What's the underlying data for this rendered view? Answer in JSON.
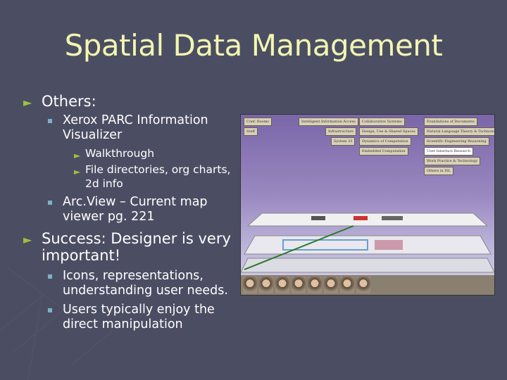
{
  "slide": {
    "title": "Spatial Data Management",
    "bullets": [
      {
        "text": "Others:",
        "sub": [
          {
            "lines": [
              "Xerox PARC Information",
              "Visualizer"
            ],
            "sub": [
              {
                "lines": [
                  "Walkthrough"
                ]
              },
              {
                "lines": [
                  "File directories, org charts,",
                  "2d info"
                ]
              }
            ]
          },
          {
            "lines": [
              "Arc.View – Current map",
              "viewer pg. 221"
            ]
          }
        ]
      },
      {
        "lines": [
          "Success: Designer is very",
          "important!"
        ],
        "sub": [
          {
            "lines": [
              "Icons, representations,",
              "understanding user needs."
            ]
          },
          {
            "lines": [
              "Users typically enjoy the",
              "direct manipulation"
            ]
          }
        ]
      }
    ]
  },
  "screenshot": {
    "labels": [
      "Conf. Rooms",
      "Staff",
      "Intelligent Information Access",
      "Infrastructure",
      "System 33",
      "Collaborative Systems",
      "Design, Use & Shared Spaces",
      "Dynamics of Computation",
      "Embedded Computation",
      "Foundations of Documents",
      "Natural Language Theory & Technology",
      "Scientific Engineering Reasoning",
      "User Interface Research",
      "Work Practice & Technology",
      "Others in ISL"
    ]
  },
  "colors": {
    "background": "#4b4e63",
    "title": "#f2f6b0",
    "bullet": "#9cc33a",
    "sub_bullet": "#7fb0c8"
  }
}
